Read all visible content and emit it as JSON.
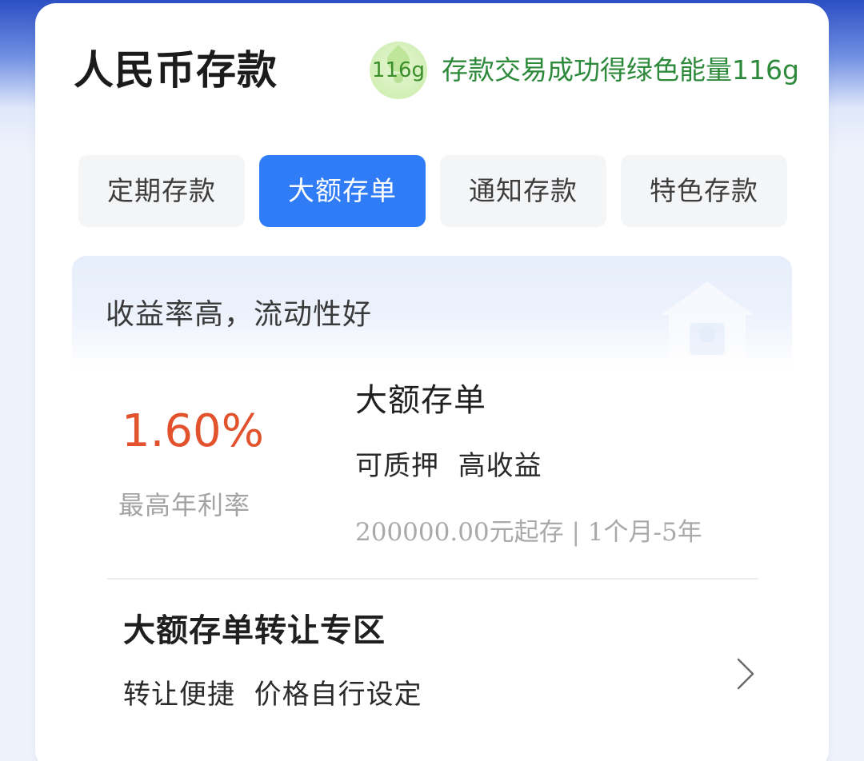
{
  "header": {
    "title": "人民币存款",
    "energy_badge": "116g",
    "energy_text": "存款交易成功得绿色能量116g"
  },
  "tabs": [
    {
      "label": "定期存款",
      "active": false
    },
    {
      "label": "大额存单",
      "active": true
    },
    {
      "label": "通知存款",
      "active": false
    },
    {
      "label": "特色存款",
      "active": false
    }
  ],
  "promo": {
    "text": "收益率高，流动性好"
  },
  "product": {
    "rate": "1.60%",
    "rate_label": "最高年利率",
    "name": "大额存单",
    "tags": "可质押  高收益",
    "info": "200000.00元起存 | 1个月-5年"
  },
  "transfer": {
    "title": "大额存单转让专区",
    "desc": "转让便捷  价格自行设定"
  },
  "colors": {
    "accent": "#2f7cf6",
    "rate": "#e2522c",
    "energy": "#2e8a3b"
  }
}
